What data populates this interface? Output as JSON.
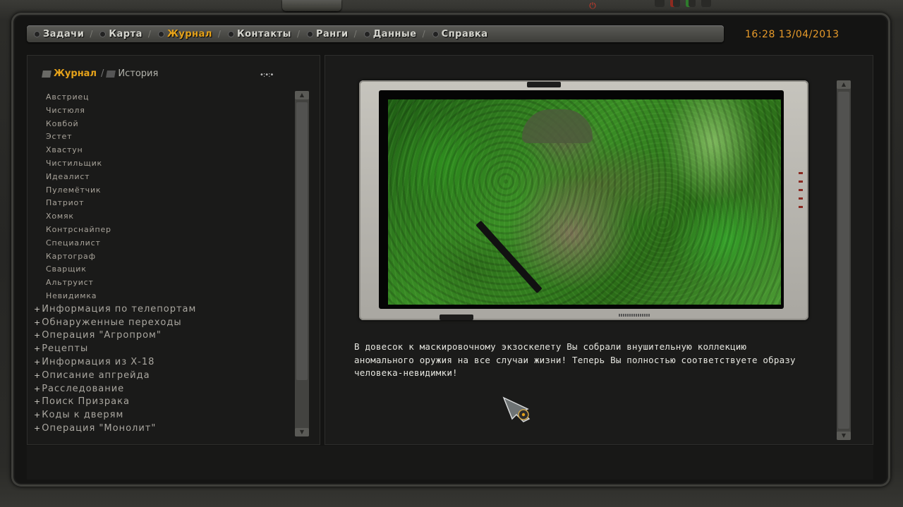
{
  "menu": {
    "items": [
      {
        "label": "Задачи",
        "active": false
      },
      {
        "label": "Карта",
        "active": false
      },
      {
        "label": "Журнал",
        "active": true
      },
      {
        "label": "Контакты",
        "active": false
      },
      {
        "label": "Ранги",
        "active": false
      },
      {
        "label": "Данные",
        "active": false
      },
      {
        "label": "Справка",
        "active": false
      }
    ],
    "clock": "16:28  13/04/2013"
  },
  "colors": {
    "accent": "#e5a21a",
    "clock": "#e79a2a",
    "text": "#a8a39a"
  },
  "subtabs": {
    "journal": "Журнал",
    "history": "История"
  },
  "journal": {
    "entries": [
      "Австриец",
      "Чистюля",
      "Ковбой",
      "Эстет",
      "Хвастун",
      "Чистильщик",
      "Идеалист",
      "Пулемётчик",
      "Патриот",
      "Хомяк",
      "Контрснайпер",
      "Специалист",
      "Картограф",
      "Сварщик",
      "Альтруист",
      "Невидимка"
    ],
    "sections": [
      "Информация по телепортам",
      "Обнаруженные переходы",
      "Операция \"Агропром\"",
      "Рецепты",
      "Информация из Х-18",
      "Описание апгрейда",
      "Расследование",
      "Поиск Призрака",
      "Коды к дверям",
      "Операция \"Монолит\""
    ]
  },
  "description": {
    "text": "В довесок к маскировочному экзоскелету Вы собрали внушительную коллекцию аномального оружия на все случаи жизни! Теперь Вы полностью соответствуете образу человека-невидимки!"
  },
  "icons": [
    "power-icon",
    "menu-bullet-icon",
    "journal-tab-icon",
    "history-tab-icon",
    "dots-icon",
    "plus-icon",
    "scroll-arrow-icon",
    "pda-cursor-icon"
  ]
}
